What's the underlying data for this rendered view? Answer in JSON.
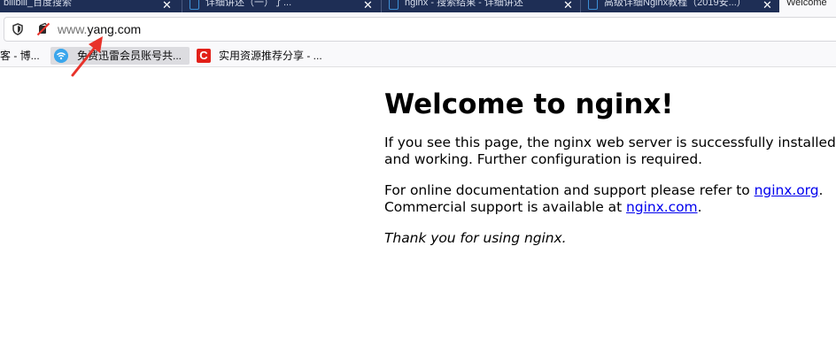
{
  "tabs": [
    {
      "title": "bilibili_百度搜索"
    },
    {
      "title": "详细讲述（一）了..."
    },
    {
      "title": "nginx - 搜索结果 - 详细讲述"
    },
    {
      "title": "高级详细Nginx教程（2019安...）"
    },
    {
      "title": "Welcome"
    }
  ],
  "address_bar": {
    "url_prefix": "www.",
    "url_domain": "yang.com"
  },
  "bookmarks": [
    {
      "label": "客 - 博..."
    },
    {
      "label": "免费迅雷会员账号共..."
    },
    {
      "label": "实用资源推荐分享 - ..."
    }
  ],
  "page": {
    "heading": "Welcome to nginx!",
    "para1": "If you see this page, the nginx web server is successfully installed and working. Further configuration is required.",
    "para2_a": "For online documentation and support please refer to ",
    "link_org": "nginx.org",
    "para2_b": ".",
    "para2_c": "Commercial support is available at ",
    "link_com": "nginx.com",
    "para2_d": ".",
    "thanks": "Thank you for using nginx."
  },
  "colors": {
    "tabstrip": "#1e2e55",
    "link": "#0000ee",
    "annotation": "#e8322a"
  }
}
